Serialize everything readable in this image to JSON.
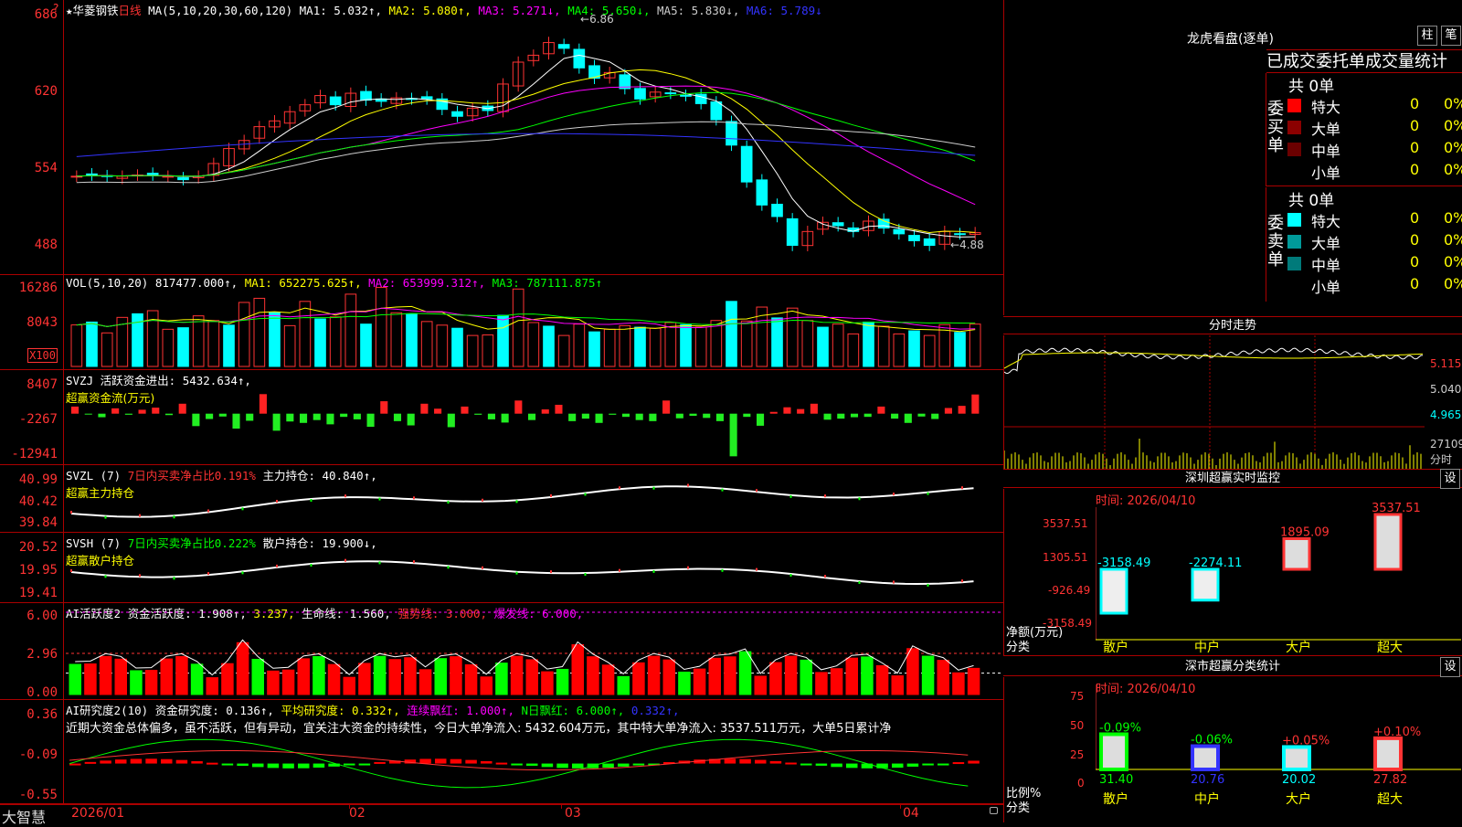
{
  "stock": {
    "name": "★华菱钢铁",
    "period": "日线"
  },
  "main": {
    "ma_label": "MA(5,10,20,30,60,120)",
    "ma1": "MA1: 5.032↑,",
    "ma2": "MA2: 5.080↑,",
    "ma3": "MA3: 5.271↓,",
    "ma4": "MA4: 5.650↓,",
    "ma5": "MA5: 5.830↓,",
    "ma6": "MA6: 5.789↓",
    "high": "6.86",
    "low": "4.88",
    "axis": [
      "686",
      "620",
      "554",
      "488"
    ]
  },
  "vol": {
    "label": "VOL(5,10,20)",
    "val": "817477.000↑,",
    "ma1": "MA1: 652275.625↑,",
    "ma2": "MA2: 653999.312↑,",
    "ma3": "MA3: 787111.875↑",
    "axis": [
      "16286",
      "8043"
    ],
    "unit": "X100"
  },
  "svzj": {
    "label": "SVZJ",
    "line1": "活跃资金进出: 5432.634↑,",
    "line2": "超赢资金流(万元)",
    "axis": [
      "8407",
      "-2267",
      "-12941"
    ]
  },
  "svzl": {
    "label": "SVZL (7)",
    "pct": "7日内买卖净占比0.191%",
    "pos": "主力持仓: 40.840↑,",
    "title": "超赢主力持仓",
    "axis": [
      "40.99",
      "40.42",
      "39.84"
    ]
  },
  "svsh": {
    "label": "SVSH (7)",
    "pct": "7日内买卖净占比0.222%",
    "pos": "散户持仓: 19.900↓,",
    "title": "超赢散户持仓",
    "axis": [
      "20.52",
      "19.95",
      "19.41"
    ]
  },
  "ai1": {
    "label": "AI活跃度2",
    "v1": "资金活跃度: 1.908↑,",
    "v2": "3.237,",
    "v3": "生命线: 1.560,",
    "v4": "强势线: 3.000,",
    "v5": "爆发线: 6.000,",
    "axis": [
      "6.00",
      "2.96",
      "0.00"
    ]
  },
  "ai2": {
    "label": "AI研究度2(10)",
    "v1": "资金研究度: 0.136↑,",
    "v2": "平均研究度: 0.332↑,",
    "v3": "连续飘红: 1.000↑,",
    "v4": "N日飘红: 6.000↑,",
    "v5": "0.332↑,",
    "comment": "近期大资金总体偏多，虽不活跃，但有异动，宜关注大资金的持续性，今日大单净流入: 5432.604万元，其中特大单净流入: 3537.511万元，大单5日累计净",
    "axis": [
      "0.36",
      "-0.09",
      "-0.55"
    ]
  },
  "xaxis": [
    "2026/01",
    "02",
    "03",
    "04"
  ],
  "logo": "大智慧",
  "lhb": {
    "title": "龙虎看盘(逐单)",
    "btn1": "柱",
    "btn2": "笔",
    "header": "已成交委托单成交量统计",
    "buy_label": "委买单",
    "sell_label": "委卖单",
    "buy_total": "共 0单",
    "sell_total": "共 0单",
    "rows": [
      {
        "name": "特大",
        "qty": "0",
        "pct": "0%"
      },
      {
        "name": "大单",
        "qty": "0",
        "pct": "0%"
      },
      {
        "name": "中单",
        "qty": "0",
        "pct": "0%"
      },
      {
        "name": "小单",
        "qty": "0",
        "pct": "0%"
      }
    ],
    "buy_colors": [
      "#ff0000",
      "#8b0000",
      "#6b0000",
      ""
    ],
    "sell_colors": [
      "#00ffff",
      "#009a9a",
      "#007a7a",
      ""
    ]
  },
  "fenshi": {
    "title": "分时走势",
    "axis": [
      "5.115",
      "5.040",
      "4.965"
    ],
    "vol": "27109",
    "vol_unit": "分时"
  },
  "sz": {
    "title": "深圳超赢实时监控",
    "btn": "设",
    "time": "时间: 2026/04/10",
    "axis": [
      "3537.51",
      "1305.51",
      "-926.49",
      "-3158.49"
    ],
    "ylabel": "净额(万元)",
    "xlabel": "分类",
    "cats": [
      "散户",
      "中户",
      "大户",
      "超大"
    ],
    "labels": [
      "-3158.49",
      "-2274.11",
      "1895.09",
      "3537.51"
    ]
  },
  "ss": {
    "title": "深市超赢分类统计",
    "btn": "设",
    "time": "时间: 2026/04/10",
    "axis": [
      "75",
      "50",
      "25",
      "0"
    ],
    "ylabel": "比例%",
    "xlabel": "分类",
    "cats": [
      "散户",
      "中户",
      "大户",
      "超大"
    ],
    "chg": [
      "-0.09%",
      "-0.06%",
      "+0.05%",
      "+0.10%"
    ],
    "vals": [
      "31.40",
      "20.76",
      "20.02",
      "27.82"
    ]
  },
  "chart_data": [
    {
      "type": "candlestick",
      "title": "华菱钢铁 日线",
      "ylim": [
        4.88,
        6.86
      ],
      "x": [
        "2026/01",
        "02",
        "03",
        "04"
      ],
      "close": [
        5.55,
        5.56,
        5.55,
        5.55,
        5.56,
        5.56,
        5.55,
        5.52,
        5.55,
        5.66,
        5.79,
        5.86,
        5.98,
        6.03,
        6.11,
        6.17,
        6.25,
        6.17,
        6.27,
        6.21,
        6.2,
        6.23,
        6.22,
        6.22,
        6.13,
        6.07,
        6.14,
        6.12,
        6.35,
        6.54,
        6.6,
        6.71,
        6.66,
        6.49,
        6.4,
        6.45,
        6.31,
        6.22,
        6.28,
        6.27,
        6.25,
        6.18,
        6.04,
        5.82,
        5.5,
        5.3,
        5.2,
        4.95,
        5.07,
        5.15,
        5.12,
        5.07,
        5.16,
        5.1,
        5.05,
        4.99,
        4.95,
        5.07,
        5.05,
        5.06
      ],
      "ma": {
        "MA1": 5.032,
        "MA2": 5.08,
        "MA3": 5.271,
        "MA4": 5.65,
        "MA5": 5.83,
        "MA6": 5.789
      }
    },
    {
      "type": "bar",
      "title": "VOL(5,10,20)",
      "last": 817477.0,
      "ma": {
        "MA1": 652275.625,
        "MA2": 653999.312,
        "MA3": 787111.875
      },
      "ylim": [
        0,
        16286
      ],
      "values": [
        8043,
        8600,
        6500,
        9500,
        10200,
        10800,
        7200,
        7500,
        9800,
        8900,
        8000,
        12400,
        13200,
        10500,
        7900,
        12600,
        9200,
        9600,
        14000,
        8200,
        15300,
        10400,
        10200,
        8700,
        8000,
        7400,
        6000,
        6100,
        9900,
        15000,
        8500,
        7800,
        6000,
        8200,
        6700,
        7200,
        7900,
        7600,
        7400,
        8500,
        8100,
        7600,
        8900,
        12600,
        8800,
        11500,
        9400,
        11300,
        8900,
        7600,
        8200,
        6300,
        8600,
        7800,
        6300,
        6900,
        6000,
        8100,
        6600,
        8200
      ]
    },
    {
      "type": "bar",
      "title": "超赢资金流(万元)",
      "last": 5432.634,
      "ylim": [
        -12941,
        8407
      ],
      "values": [
        2000,
        -200,
        -1000,
        1500,
        -300,
        1100,
        1700,
        -400,
        2800,
        -3500,
        -1500,
        -800,
        -4200,
        -2000,
        5500,
        -4800,
        -2200,
        -2600,
        -1800,
        -3000,
        -900,
        -1600,
        -3700,
        3500,
        -2100,
        -3300,
        2800,
        1400,
        -3800,
        2000,
        -300,
        -1600,
        -2500,
        3700,
        -1800,
        1200,
        2500,
        -2100,
        -1400,
        -2600,
        -300,
        -900,
        -1800,
        -2100,
        3700,
        -1300,
        -600,
        -1200,
        -2100,
        -12000,
        -900,
        -3400,
        500,
        1800,
        1300,
        2800,
        -1700,
        -1400,
        -1000,
        -900,
        2000,
        -1400,
        -2600,
        -800,
        -1500,
        1600,
        2200,
        5400
      ]
    },
    {
      "type": "line",
      "title": "超赢主力持仓",
      "ylim": [
        39.84,
        40.99
      ],
      "last": 40.84
    },
    {
      "type": "line",
      "title": "超赢散户持仓",
      "ylim": [
        19.41,
        20.52
      ],
      "last": 19.9
    },
    {
      "type": "bar",
      "title": "AI活跃度2",
      "ylim": [
        0,
        6
      ],
      "levels": {
        "资金活跃度": 1.908,
        "生命线": 1.56,
        "强势线": 3.0,
        "爆发线": 6.0
      }
    },
    {
      "type": "bar",
      "title": "AI研究度2(10)",
      "ylim": [
        -0.55,
        0.36
      ],
      "levels": {
        "资金研究度": 0.136,
        "平均研究度": 0.332
      }
    },
    {
      "type": "bar",
      "title": "深圳超赢实时监控",
      "categories": [
        "散户",
        "中户",
        "大户",
        "超大"
      ],
      "values": [
        -3158.49,
        -2274.11,
        1895.09,
        3537.51
      ],
      "ylim": [
        -3158.49,
        3537.51
      ],
      "ylabel": "净额(万元)"
    },
    {
      "type": "bar",
      "title": "深市超赢分类统计",
      "categories": [
        "散户",
        "中户",
        "大户",
        "超大"
      ],
      "values": [
        31.4,
        20.76,
        20.02,
        27.82
      ],
      "ylim": [
        0,
        75
      ],
      "ylabel": "比例%"
    }
  ]
}
